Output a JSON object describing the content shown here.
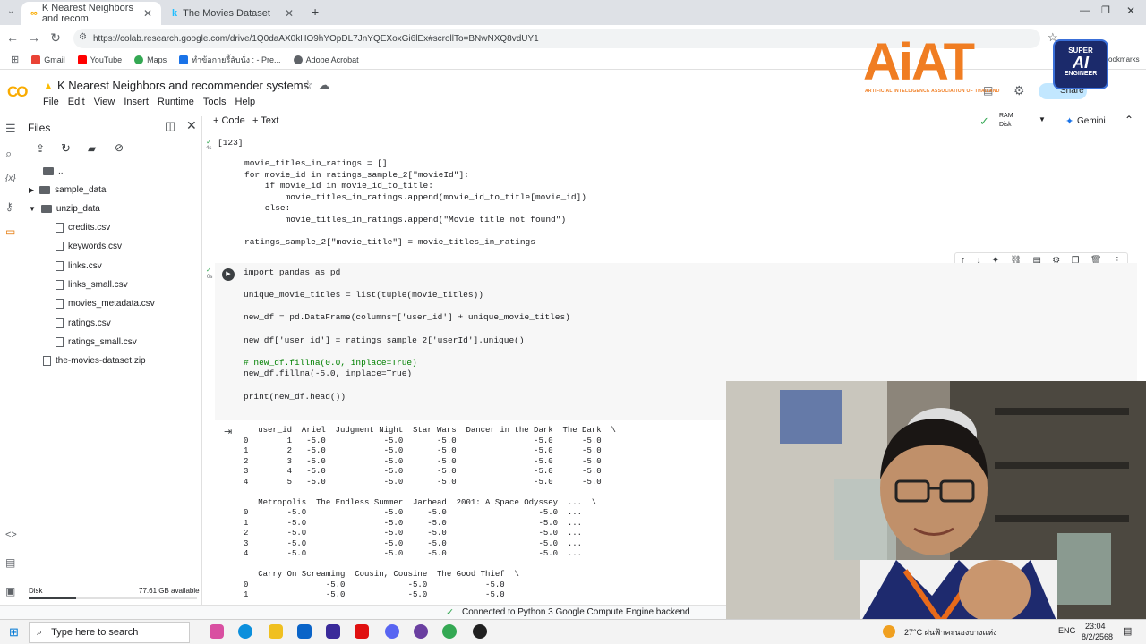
{
  "browser": {
    "tabs": [
      {
        "title": "K Nearest Neighbors and recom",
        "active": true
      },
      {
        "title": "The Movies Dataset",
        "active": false
      }
    ],
    "url": "https://colab.research.google.com/drive/1Q0daAX0kHO9hYOpDL7JnYQEXoxGi6lEx#scrollTo=BNwNXQ8vdUY1",
    "bookmarks": [
      "Gmail",
      "YouTube",
      "Maps",
      "ทำข้อกายรี้ลับนั่ง : - Pre...",
      "Adobe Acrobat"
    ],
    "bookmarks_right": "ookmarks"
  },
  "colab": {
    "logo": "CO",
    "title": "K Nearest Neighbors and recommender systems",
    "menu": [
      "File",
      "Edit",
      "View",
      "Insert",
      "Runtime",
      "Tools",
      "Help"
    ],
    "share": "Share",
    "toolbar": {
      "code": "+ Code",
      "text": "+ Text",
      "ram": "RAM",
      "disk": "Disk",
      "gemini": "Gemini"
    }
  },
  "files_panel": {
    "title": "Files",
    "items": [
      {
        "name": "..",
        "type": "folder",
        "depth": 0
      },
      {
        "name": "sample_data",
        "type": "folder",
        "depth": 0
      },
      {
        "name": "unzip_data",
        "type": "folder",
        "depth": 0
      },
      {
        "name": "credits.csv",
        "type": "file",
        "depth": 1
      },
      {
        "name": "keywords.csv",
        "type": "file",
        "depth": 1
      },
      {
        "name": "links.csv",
        "type": "file",
        "depth": 1
      },
      {
        "name": "links_small.csv",
        "type": "file",
        "depth": 1
      },
      {
        "name": "movies_metadata.csv",
        "type": "file",
        "depth": 1
      },
      {
        "name": "ratings.csv",
        "type": "file",
        "depth": 1
      },
      {
        "name": "ratings_small.csv",
        "type": "file",
        "depth": 1
      },
      {
        "name": "the-movies-dataset.zip",
        "type": "file",
        "depth": 0
      }
    ],
    "disk_label": "Disk",
    "disk_available": "77.61 GB available",
    "disk_used_fraction": 0.28
  },
  "cell1": {
    "exec_count": "[123]",
    "time": "4s",
    "code": [
      "movie_titles_in_ratings = []",
      "for movie_id in ratings_sample_2[\"movieId\"]:",
      "    if movie_id in movie_id_to_title:",
      "        movie_titles_in_ratings.append(movie_id_to_title[movie_id])",
      "    else:",
      "        movie_titles_in_ratings.append(\"Movie title not found\")",
      "",
      "ratings_sample_2[\"movie_title\"] = movie_titles_in_ratings"
    ]
  },
  "cell2": {
    "time": "0s",
    "code": [
      "import pandas as pd",
      "",
      "unique_movie_titles = list(tuple(movie_titles))",
      "",
      "new_df = pd.DataFrame(columns=['user_id'] + unique_movie_titles)",
      "",
      "new_df['user_id'] = ratings_sample_2['userId'].unique()",
      "",
      "# new_df.fillna(0.0, inplace=True)",
      "new_df.fillna(-5.0, inplace=True)",
      "",
      "print(new_df.head())"
    ],
    "output": [
      "   user_id  Ariel  Judgment Night  Star Wars  Dancer in the Dark  The Dark  \\",
      "0        1   -5.0            -5.0       -5.0                -5.0      -5.0",
      "1        2   -5.0            -5.0       -5.0                -5.0      -5.0",
      "2        3   -5.0            -5.0       -5.0                -5.0      -5.0",
      "3        4   -5.0            -5.0       -5.0                -5.0      -5.0",
      "4        5   -5.0            -5.0       -5.0                -5.0      -5.0",
      "",
      "   Metropolis  The Endless Summer  Jarhead  2001: A Space Odyssey  ...  \\",
      "0        -5.0                -5.0     -5.0                   -5.0  ...",
      "1        -5.0                -5.0     -5.0                   -5.0  ...",
      "2        -5.0                -5.0     -5.0                   -5.0  ...",
      "3        -5.0                -5.0     -5.0                   -5.0  ...",
      "4        -5.0                -5.0     -5.0                   -5.0  ...",
      "",
      "   Carry On Screaming  Cousin, Cousine  The Good Thief  \\",
      "0                -5.0             -5.0            -5.0",
      "1                -5.0             -5.0            -5.0"
    ]
  },
  "status": {
    "text": "Connected to Python 3 Google Compute Engine backend"
  },
  "overlay": {
    "brand": "AiAT",
    "brand_sub": "ARTIFICIAL INTELLIGENCE ASSOCIATION OF THAILAND",
    "badge_line1": "SUPER",
    "badge_line2": "AI",
    "badge_line3": "ENGINEER"
  },
  "taskbar": {
    "search_placeholder": "Type here to search",
    "weather": "27°C  ฝนฟ้าคะนองบางแห่ง",
    "lang": "ENG",
    "time": "23:04",
    "date": "8/2/2568"
  }
}
